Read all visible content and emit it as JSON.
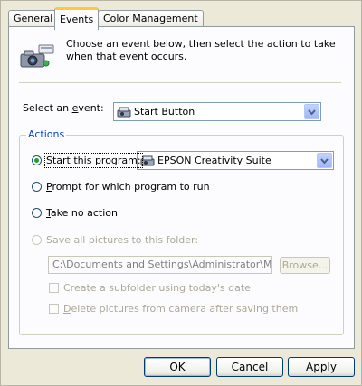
{
  "tabs": [
    {
      "label": "General"
    },
    {
      "label": "Events",
      "active": true
    },
    {
      "label": "Color Management"
    }
  ],
  "intro": {
    "text": "Choose an event below, then select the action to take when that event occurs.",
    "icon": "camera-scanner-icon"
  },
  "event": {
    "label_pre": "Select an ",
    "label_key": "e",
    "label_post": "vent:",
    "selected": "Start Button",
    "icon": "scanner-icon"
  },
  "actions": {
    "group_title": "Actions",
    "start_program": {
      "pre": "",
      "key": "S",
      "post": "tart this program:",
      "checked": true
    },
    "program_selected": "EPSON Creativity Suite",
    "program_icon": "scanner-icon",
    "prompt": {
      "pre": "",
      "key": "P",
      "post": "rompt for which program to run"
    },
    "no_action": {
      "pre": "",
      "key": "T",
      "post": "ake no action"
    },
    "save_pictures": "Save all pictures to this folder:",
    "folder_path": "C:\\Documents and Settings\\Administrator\\My Docu",
    "browse_label": "Browse...",
    "subfolder": "Create a subfolder using today's date",
    "delete_pictures": {
      "pre": "",
      "key": "D",
      "post": "elete pictures from camera after saving them"
    }
  },
  "buttons": {
    "ok": "OK",
    "cancel": "Cancel",
    "apply_key": "A",
    "apply_rest": "pply"
  },
  "colors": {
    "accent": "#0046d5",
    "tab_highlight": "#ffc83c",
    "radio_dot": "#21a121"
  }
}
